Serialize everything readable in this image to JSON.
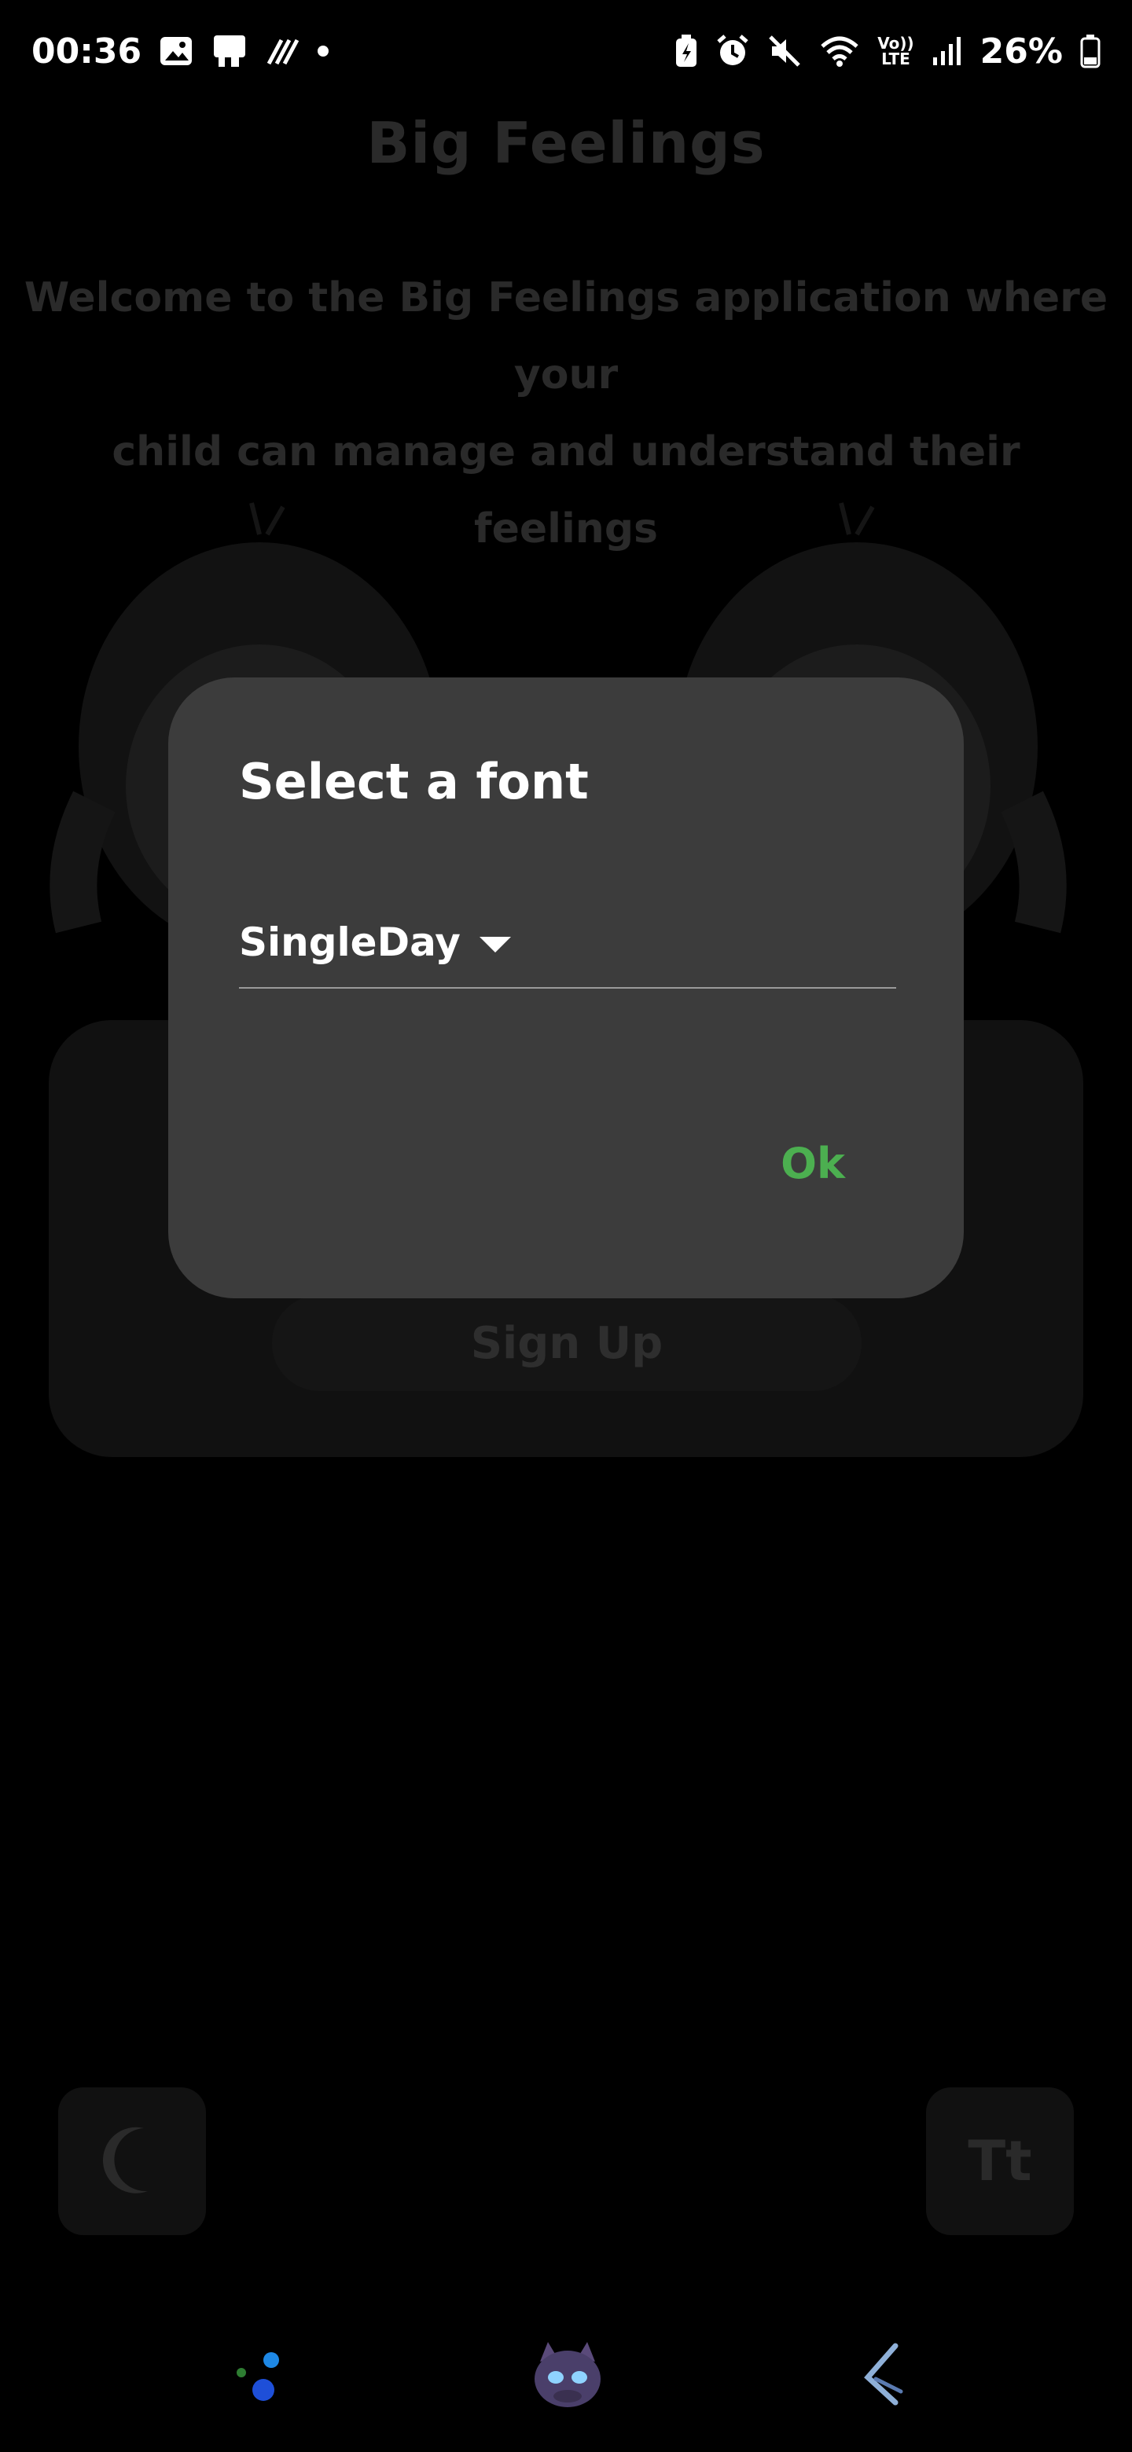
{
  "status_bar": {
    "time": "00:36",
    "battery": "26%",
    "icons": [
      "image-icon",
      "display-icon",
      "data-icon",
      "dot-icon",
      "battery-saver-icon",
      "alarm-icon",
      "mute-icon",
      "wifi-icon",
      "volte-icon",
      "signal-icon",
      "battery-icon"
    ],
    "volte_label_top": "Vo))",
    "volte_label_bottom": "LTE"
  },
  "app": {
    "title": "Big Feelings",
    "welcome_line1": "Welcome to the Big Feelings application where your",
    "welcome_line2": "child can manage and understand their feelings",
    "signup_label": "Sign Up",
    "font_button_label": "Tt"
  },
  "dialog": {
    "title": "Select a font",
    "selected_font": "SingleDay",
    "ok_label": "Ok",
    "accent_color": "#4caf50"
  },
  "nav": {
    "items": [
      "assistant-dots-icon",
      "avatar-icon",
      "back-icon"
    ]
  }
}
